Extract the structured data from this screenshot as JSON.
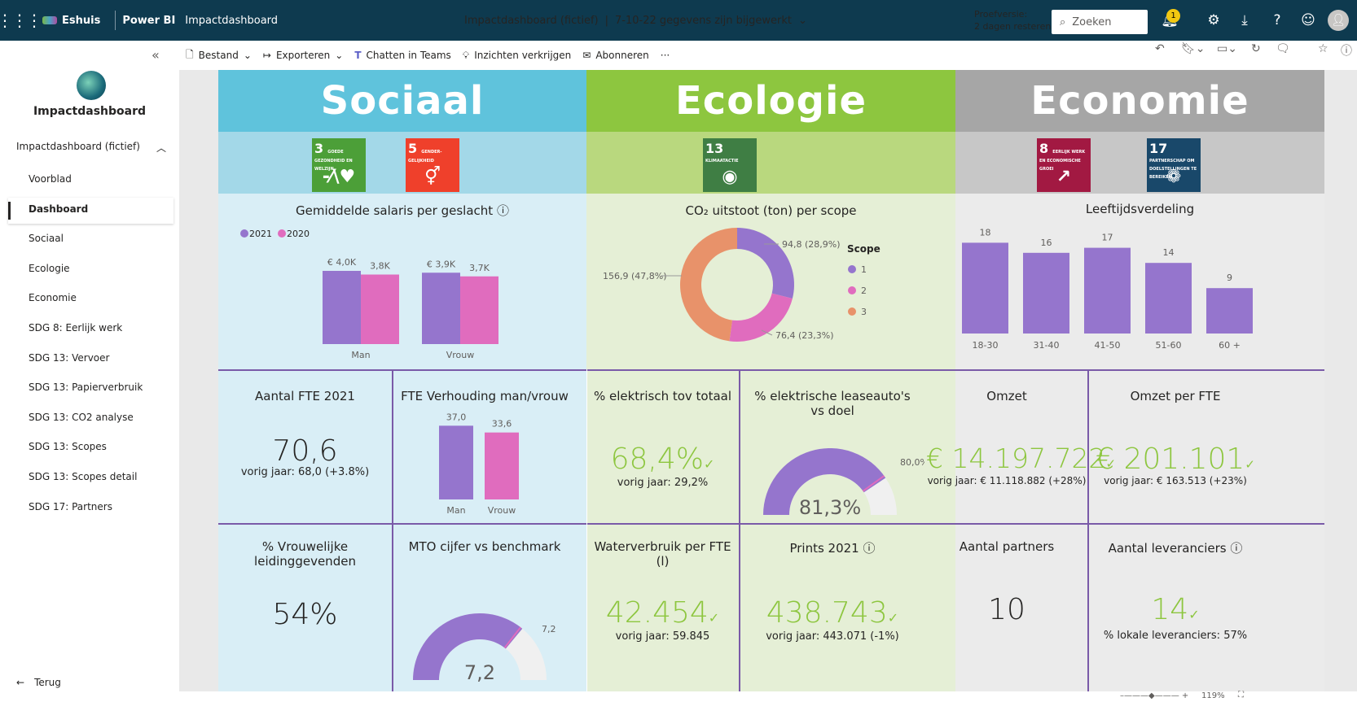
{
  "topbar": {
    "brand": "Eshuis",
    "product": "Power BI",
    "report": "Impactdashboard",
    "title": "Impactdashboard (fictief)",
    "separator": "|",
    "updated": "7-10-22 gegevens zijn bijgewerkt",
    "trial_line1": "Proefversie:",
    "trial_line2": "2 dagen resterend",
    "search_placeholder": "Zoeken",
    "notifications": "1"
  },
  "sidebar": {
    "workspace": "Impactdashboard",
    "group": "Impactdashboard (fictief)",
    "items": [
      "Voorblad",
      "Dashboard",
      "Sociaal",
      "Ecologie",
      "Economie",
      "SDG 8: Eerlijk werk",
      "SDG 13: Vervoer",
      "SDG 13: Papierverbruik",
      "SDG 13: CO2 analyse",
      "SDG 13: Scopes",
      "SDG 13: Scopes detail",
      "SDG 17: Partners"
    ],
    "active": "Dashboard",
    "back": "Terug"
  },
  "toolbar": {
    "file": "Bestand",
    "export": "Exporteren",
    "teams": "Chatten in Teams",
    "insights": "Inzichten verkrijgen",
    "subscribe": "Abonneren",
    "more": "···"
  },
  "colors": {
    "sociaal": "#5fc3dc",
    "ecologie": "#8dc63f",
    "economie": "#a6a6a6",
    "purple": "#9575cd",
    "pink": "#e06cbe",
    "orange": "#e8926a",
    "gauge": "#9575cd"
  },
  "headers": {
    "sociaal": "Sociaal",
    "ecologie": "Ecologie",
    "economie": "Economie"
  },
  "sdgs": [
    {
      "num": "3",
      "text": "GOEDE GEZONDHEID EN WELZIJN",
      "color": "#4c9f38",
      "icon": "heartbeat-icon",
      "glyph": "-⁄\\♥"
    },
    {
      "num": "5",
      "text": "GENDER-GELIJKHEID",
      "color": "#ef402b",
      "icon": "gender-icon",
      "glyph": "⚥"
    },
    {
      "num": "13",
      "text": "KLIMAATACTIE",
      "color": "#3f7e44",
      "icon": "eye-globe-icon",
      "glyph": "◉"
    },
    {
      "num": "8",
      "text": "EERLIJK WERK EN ECONOMISCHE GROEI",
      "color": "#a21942",
      "icon": "growth-chart-icon",
      "glyph": "↗"
    },
    {
      "num": "17",
      "text": "PARTNERSCHAP OM DOELSTELLINGEN TE BEREIKEN",
      "color": "#19486a",
      "icon": "rings-icon",
      "glyph": "❁"
    }
  ],
  "chart_data": [
    {
      "type": "bar",
      "title": "Gemiddelde salaris per geslacht",
      "categories": [
        "Man",
        "Vrouw"
      ],
      "series": [
        {
          "name": "2021",
          "values": [
            4.0
          ],
          "labels": [
            "€ 4,0K"
          ]
        },
        {
          "name": "2020",
          "values": [
            3.8
          ],
          "labels": [
            "3,8K"
          ]
        }
      ],
      "series_all": [
        {
          "name": "2021",
          "values": [
            4.0,
            3.9
          ],
          "labels": [
            "€ 4,0K",
            "€ 3,9K"
          ]
        },
        {
          "name": "2020",
          "values": [
            3.8,
            3.7
          ],
          "labels": [
            "3,8K",
            "3,7K"
          ]
        }
      ],
      "legend": [
        "2021",
        "2020"
      ]
    },
    {
      "type": "pie",
      "title": "CO₂ uitstoot (ton) per scope",
      "legend_title": "Scope",
      "slices": [
        {
          "name": "1",
          "value": 94.8,
          "label": "94,8 (28,9%)"
        },
        {
          "name": "2",
          "value": 76.4,
          "label": "76,4 (23,3%)"
        },
        {
          "name": "3",
          "value": 156.9,
          "label": "156,9 (47,8%)"
        }
      ]
    },
    {
      "type": "bar",
      "title": "Leeftijdsverdeling",
      "categories": [
        "18-30",
        "31-40",
        "41-50",
        "51-60",
        "60 +"
      ],
      "values": [
        18,
        16,
        17,
        14,
        9
      ]
    },
    {
      "type": "bar",
      "title": "FTE Verhouding man/vrouw",
      "categories": [
        "Man",
        "Vrouw"
      ],
      "values": [
        37.0,
        33.6
      ],
      "labels": [
        "37,0",
        "33,6"
      ]
    }
  ],
  "kpis": {
    "fte": {
      "title": "Aantal FTE 2021",
      "value": "70,6",
      "sub": "vorig jaar: 68,0 (+3.8%)"
    },
    "elek": {
      "title": "% elektrisch tov totaal",
      "value": "68,4%",
      "sub": "vorig jaar: 29,2%"
    },
    "lease": {
      "title": "% elektrische leaseauto's vs doel",
      "value": "81,3%",
      "target": "80,0%",
      "fraction": 0.813
    },
    "omzet": {
      "title": "Omzet",
      "value": "€ 14.197.722",
      "sub": "vorig jaar: € 11.118.882 (+28%)"
    },
    "omzetfte": {
      "title": "Omzet per FTE",
      "value": "€ 201.101",
      "sub": "vorig jaar: € 163.513 (+23%)"
    },
    "vrouw": {
      "title": "% Vrouwelijke leidinggevenden",
      "value": "54%"
    },
    "mto": {
      "title": "MTO cijfer vs benchmark",
      "value": "7,2",
      "target": "7,2",
      "fraction": 0.72
    },
    "water": {
      "title": "Waterverbruik per FTE (l)",
      "value": "42.454",
      "sub": "vorig jaar: 59.845"
    },
    "prints": {
      "title": "Prints 2021",
      "value": "438.743",
      "sub": "vorig jaar: 443.071 (-1%)"
    },
    "partners": {
      "title": "Aantal partners",
      "value": "10"
    },
    "leveranciers": {
      "title": "Aantal leveranciers",
      "value": "14",
      "sub": "% lokale leveranciers: 57%"
    }
  },
  "status": {
    "zoom": "119%"
  }
}
